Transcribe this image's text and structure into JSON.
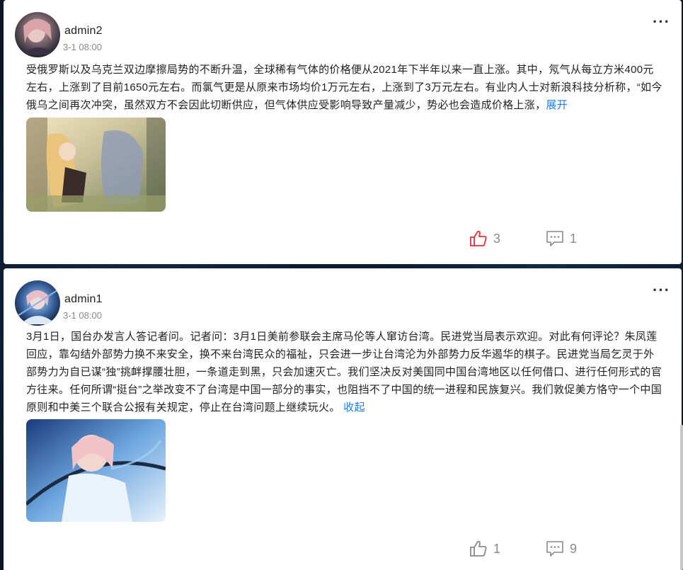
{
  "posts": [
    {
      "user": "admin2",
      "time": "3-1 08:00",
      "text": "受俄罗斯以及乌克兰双边摩擦局势的不断升温，全球稀有气体的价格便从2021年下半年以来一直上涨。其中，氖气从每立方米400元左右，上涨到了目前1650元左右。而氯气更是从原来市场均价1万元左右，上涨到了3万元左右。有业内人士对新浪科技分析称，“如今俄乌之间再次冲突，虽然双方不会因此切断供应，但气体供应受影响导致产量减少，势必也会造成价格上涨，",
      "toggle": "展开",
      "likes": "3",
      "comments": "1",
      "liked": true
    },
    {
      "user": "admin1",
      "time": "3-1 08:00",
      "text": "3月1日，国台办发言人答记者问。记者问：3月1日美前参联会主席马伦等人窜访台湾。民进党当局表示欢迎。对此有何评论？朱凤莲回应，靠勾结外部势力换不来安全，换不来台湾民众的福祉，只会进一步让台湾沦为外部势力反华遏华的棋子。民进党当局乞灵于外部势力为自已谋“独”挑衅撑腰壮胆，一条道走到黑，只会加速灭亡。我们坚决反对美国同中国台湾地区以任何借口、进行任何形式的官方往来。任何所谓“挺台”之举改变不了台湾是中国一部分的事实，也阻挡不了中国的统一进程和民族复兴。我们敦促美方恪守一个中国原则和中美三个联合公报有关规定，停止在台湾问题上继续玩火。 ",
      "toggle": "收起",
      "likes": "1",
      "comments": "9",
      "liked": false
    }
  ],
  "more_icon": "···",
  "colors": {
    "liked": "#e0303a",
    "link": "#1c7ce6",
    "muted": "#8a8a8a"
  }
}
